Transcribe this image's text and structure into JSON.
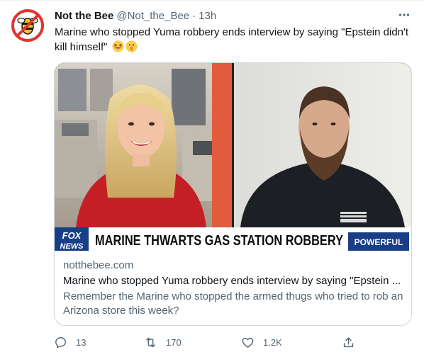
{
  "tweet": {
    "display_name": "Not the Bee",
    "handle": "@Not_the_Bee",
    "separator": "·",
    "time": "13h",
    "text": "Marine who stopped Yuma robbery ends interview by saying \"Epstein didn't kill himself\"",
    "emojis": [
      "grinning-squinting-face",
      "shushing-face"
    ]
  },
  "card": {
    "image": {
      "headline": "MARINE THWARTS GAS STATION ROBBERY",
      "network_logo_top": "FOX",
      "network_logo_bottom": "NEWS",
      "tag": "POWERFUL"
    },
    "domain": "notthebee.com",
    "title": "Marine who stopped Yuma robbery ends interview by saying \"Epstein ...",
    "description": "Remember the Marine who stopped the armed thugs who tried to rob an Arizona store this week?"
  },
  "actions": {
    "reply_count": "13",
    "retweet_count": "170",
    "like_count": "1.2K"
  },
  "colors": {
    "text_primary": "#0f1419",
    "text_secondary": "#536471",
    "border": "#cfd9de",
    "logo_red": "#e3342f",
    "logo_yellow": "#f7c325",
    "banner_blue": "#1a3e86"
  }
}
